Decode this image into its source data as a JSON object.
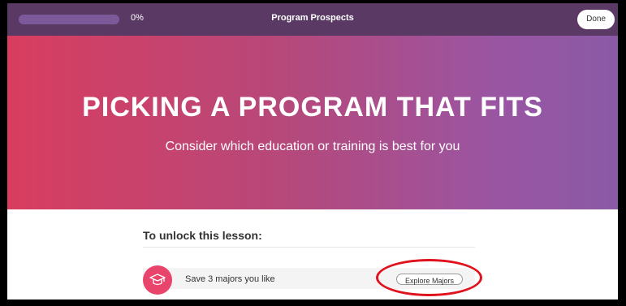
{
  "progress": {
    "percent": 0,
    "label": "0%"
  },
  "header": {
    "title": "Program Prospects",
    "done_label": "Done"
  },
  "hero": {
    "title": "PICKING A PROGRAM THAT FITS",
    "subtitle": "Consider which education or training is best for you"
  },
  "unlock": {
    "heading": "To unlock this lesson:",
    "task": {
      "icon": "graduation-cap-icon",
      "label": "Save 3 majors you like",
      "button_label": "Explore Majors"
    }
  },
  "colors": {
    "topbar": "#5a3a64",
    "gradient_start": "#d93d5f",
    "gradient_end": "#8a5aa6",
    "accent": "#e8446c",
    "highlight": "#e0121e"
  }
}
